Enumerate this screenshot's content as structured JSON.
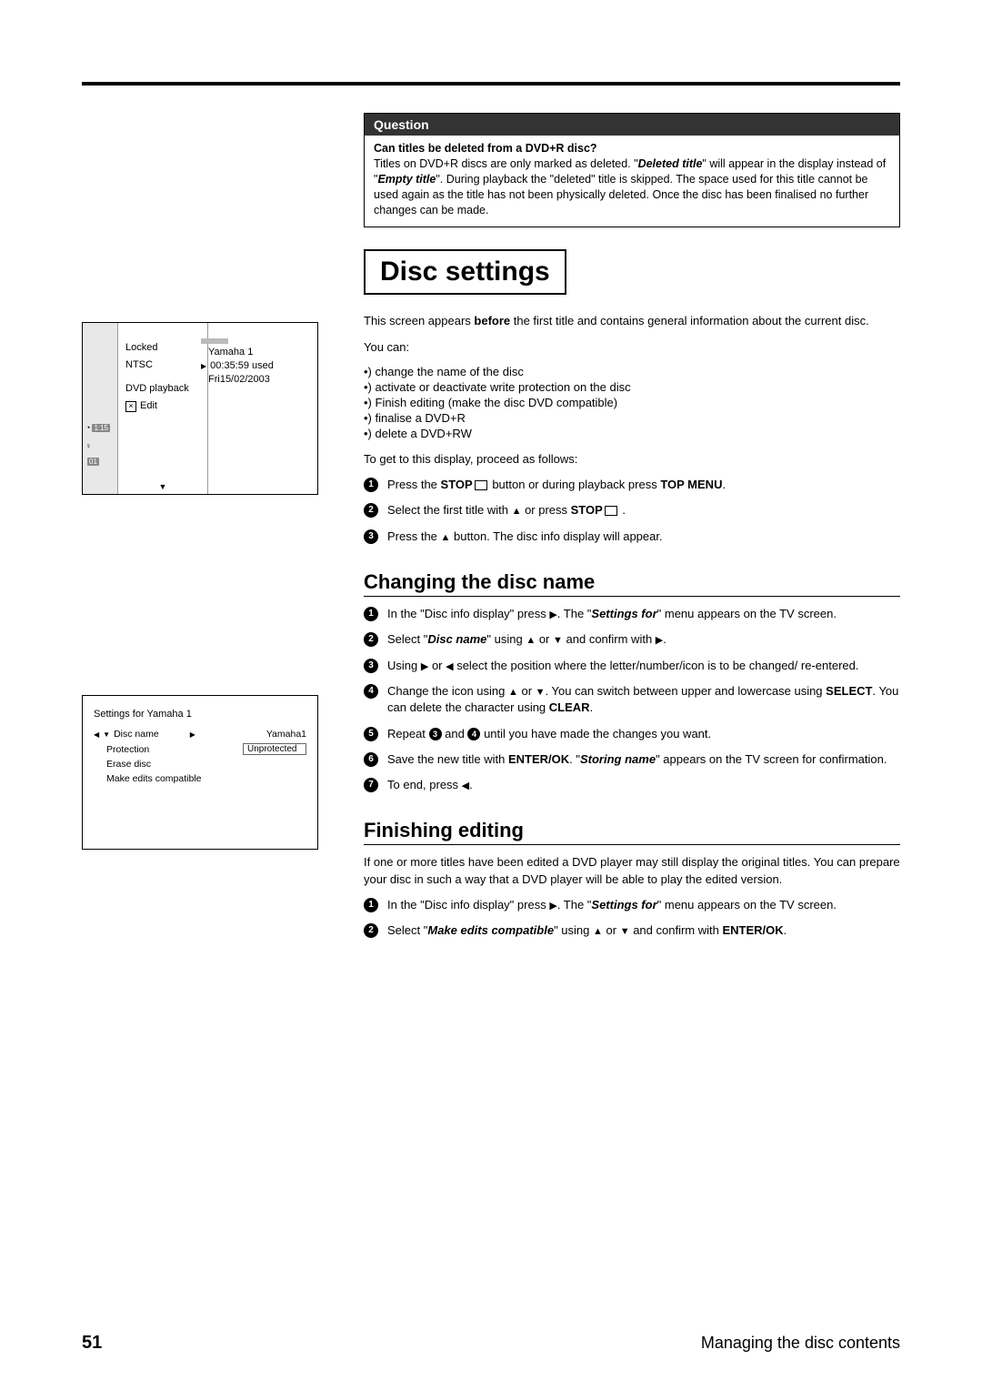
{
  "question": {
    "header": "Question",
    "title": "Can titles be deleted from a DVD+R disc?",
    "body": "Titles on DVD+R discs are only marked as deleted. \"Deleted title\" will appear in the display instead of \"Empty title\". During playback the \"deleted\" title is skipped. The space used for this title cannot be used again as the title has not been physically deleted. Once the disc has been finalised no further changes can be made."
  },
  "section1": {
    "title": "Disc settings",
    "intro_a": "This screen appears ",
    "intro_bold": "before",
    "intro_b": " the first title and contains general information about the current disc.",
    "youcan": "You can:",
    "bullets": [
      "change the name of the disc",
      "activate or deactivate write protection on the disc",
      "Finish editing (make the disc DVD compatible)",
      "finalise a DVD+R",
      "delete a DVD+RW"
    ],
    "lead2": "To get to this display, proceed as follows:",
    "step1_a": "Press the ",
    "step1_b": "STOP",
    "step1_c": " button or during playback press ",
    "step1_d": "TOP MENU",
    "step1_e": ".",
    "step2_a": "Select the first title with ",
    "step2_b": " or press ",
    "step2_c": "STOP",
    "step2_d": " .",
    "step3_a": "Press the ",
    "step3_b": " button. The disc info display will appear."
  },
  "section2": {
    "title": "Changing the disc name",
    "s1_a": "In the \"Disc info display\" press ",
    "s1_b": ". The \"",
    "s1_bold": "Settings for",
    "s1_c": "\" menu appears on the TV screen.",
    "s2_a": "Select \"",
    "s2_bold": "Disc name",
    "s2_b": "\" using ",
    "s2_c": " or ",
    "s2_d": " and confirm with ",
    "s2_e": ".",
    "s3_a": "Using ",
    "s3_b": " or ",
    "s3_c": " select the position where the letter/number/icon is to be changed/ re-entered.",
    "s4_a": "Change the icon using ",
    "s4_b": " or ",
    "s4_c": ". You can switch between upper and lowercase using ",
    "s4_bold1": "SELECT",
    "s4_d": ". You can delete the character using ",
    "s4_bold2": "CLEAR",
    "s4_e": ".",
    "s5_a": "Repeat ",
    "s5_b": " and ",
    "s5_c": " until you have made the changes you want.",
    "s6_a": "Save the new title with ",
    "s6_bold1": "ENTER/OK",
    "s6_b": ". \"",
    "s6_bold2": "Storing name",
    "s6_c": "\" appears on the TV screen for confirmation.",
    "s7_a": "To end, press ",
    "s7_b": "."
  },
  "section3": {
    "title": "Finishing editing",
    "intro": "If one or more titles have been edited a DVD player may still display the original titles. You can prepare your disc in such a way that a DVD player will be able to play the edited version.",
    "s1_a": "In the \"Disc info display\" press ",
    "s1_b": ". The \"",
    "s1_bold": "Settings for",
    "s1_c": "\" menu appears on the TV screen.",
    "s2_a": "Select \"",
    "s2_bold": "Make edits compatible",
    "s2_b": "\" using ",
    "s2_c": " or ",
    "s2_d": " and confirm with ",
    "s2_bold2": "ENTER/OK",
    "s2_e": "."
  },
  "osd1": {
    "name": "Yamaha 1",
    "used": "00:35:59 used",
    "date": "Fri15/02/2003",
    "locked": "Locked",
    "ntsc": "NTSC",
    "dvd": "DVD playback",
    "edit": "Edit",
    "time": "1:15",
    "idx": "01"
  },
  "osd2": {
    "title": "Settings for Yamaha 1",
    "rows": {
      "discname_label": "Disc name",
      "discname_val": "Yamaha1",
      "protection_label": "Protection",
      "protection_val": "Unprotected",
      "erase_label": "Erase disc",
      "make_label": "Make edits compatible"
    }
  },
  "footer": {
    "page": "51",
    "chapter": "Managing the disc contents"
  }
}
